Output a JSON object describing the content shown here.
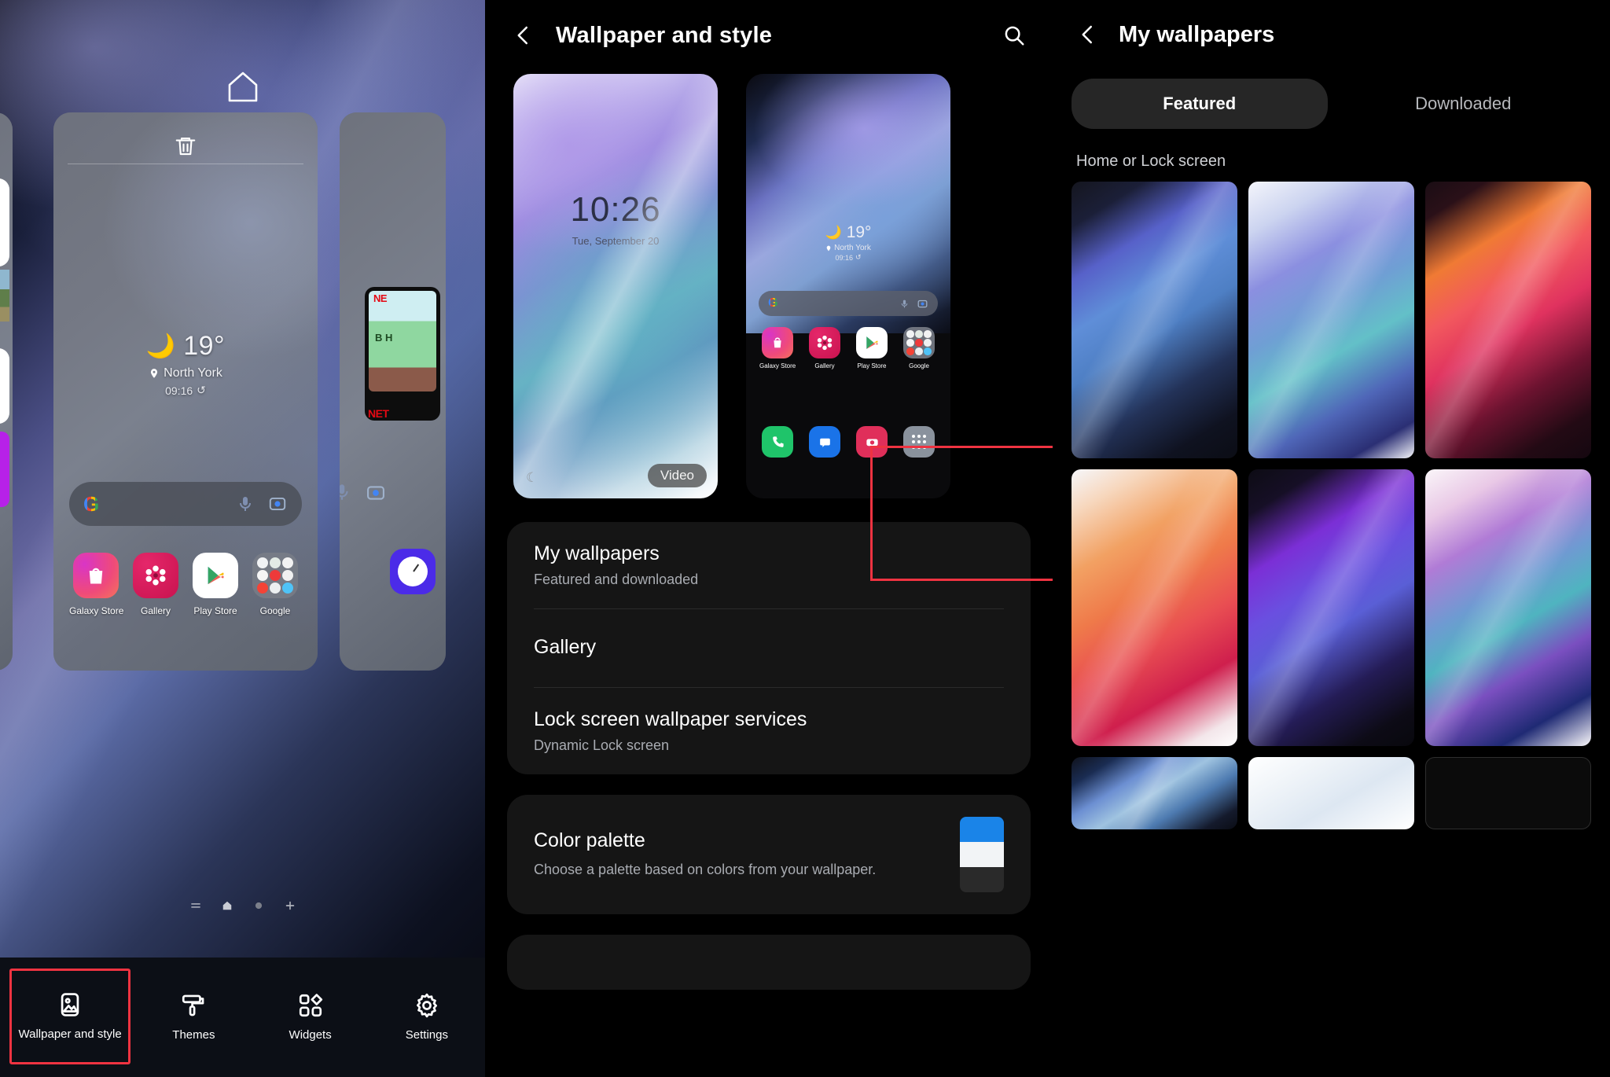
{
  "left_panel": {
    "home_icon": "home-icon",
    "trash_icon": "trash-icon",
    "weather": {
      "moon": "🌙",
      "temperature": "19°",
      "location": "North York",
      "time": "09:16",
      "refresh_icon": "↺",
      "pin_icon": "📍"
    },
    "search_bar": {
      "logo": "G",
      "mic_icon": "mic-icon",
      "lens_icon": "lens-icon"
    },
    "apps": [
      {
        "label": "Galaxy Store",
        "icon": "galaxy-store-icon"
      },
      {
        "label": "Gallery",
        "icon": "gallery-icon"
      },
      {
        "label": "Play Store",
        "icon": "play-store-icon"
      },
      {
        "label": "Google",
        "icon": "google-folder-icon"
      }
    ],
    "page_indicators": [
      "list-icon",
      "home-page-icon",
      "page-dot-icon",
      "add-page-icon"
    ],
    "tabbar": [
      {
        "label": "Wallpaper and style",
        "icon": "wallpaper-icon",
        "selected": true
      },
      {
        "label": "Themes",
        "icon": "paint-roller-icon",
        "selected": false
      },
      {
        "label": "Widgets",
        "icon": "widgets-icon",
        "selected": false
      },
      {
        "label": "Settings",
        "icon": "gear-icon",
        "selected": false
      }
    ],
    "peek_netflix": {
      "top": "NE",
      "mid": "B H",
      "bottom": "NET"
    }
  },
  "middle_panel": {
    "header": {
      "back_icon": "back-chevron-icon",
      "title": "Wallpaper and style",
      "search_icon": "search-icon"
    },
    "previews": [
      {
        "kind": "lock-screen",
        "clock": "10:26",
        "date": "Tue, September 20",
        "badge": "Video",
        "moon_icon": "moon-icon"
      },
      {
        "kind": "home-screen",
        "temperature": "19°",
        "location": "North York",
        "time": "09:16",
        "apps": [
          "Galaxy Store",
          "Gallery",
          "Play Store",
          "Google"
        ],
        "dock": [
          "phone-icon",
          "messages-icon",
          "camera-icon",
          "app-drawer-icon"
        ]
      }
    ],
    "list": [
      {
        "title": "My wallpapers",
        "subtitle": "Featured and downloaded",
        "highlighted": true
      },
      {
        "title": "Gallery",
        "subtitle": "",
        "highlighted": true
      },
      {
        "title": "Lock screen wallpaper services",
        "subtitle": "Dynamic Lock screen",
        "highlighted": false
      }
    ],
    "color_palette": {
      "title": "Color palette",
      "subtitle": "Choose a palette based on colors from your wallpaper.",
      "swatches": [
        "#1a84e8",
        "#f2f4f6",
        "#2a2a2a"
      ]
    },
    "highlight_color": "#ef3341"
  },
  "right_panel": {
    "header": {
      "back_icon": "back-chevron-icon",
      "title": "My wallpapers"
    },
    "tabs": [
      {
        "label": "Featured",
        "active": true
      },
      {
        "label": "Downloaded",
        "active": false
      }
    ],
    "section_title": "Home or Lock screen",
    "wallpapers": [
      {
        "name": "dark-blue-brush",
        "class": "w1"
      },
      {
        "name": "light-blue-violet-brush",
        "class": "w2"
      },
      {
        "name": "dark-orange-red-brush",
        "class": "w3"
      },
      {
        "name": "light-orange-red-brush",
        "class": "w4"
      },
      {
        "name": "dark-purple-brush",
        "class": "w5"
      },
      {
        "name": "light-pink-teal-brush",
        "class": "w6"
      },
      {
        "name": "dark-blue-partial",
        "class": "w7"
      },
      {
        "name": "white-partial",
        "class": "w8"
      },
      {
        "name": "empty-partial",
        "class": "w9"
      }
    ]
  }
}
